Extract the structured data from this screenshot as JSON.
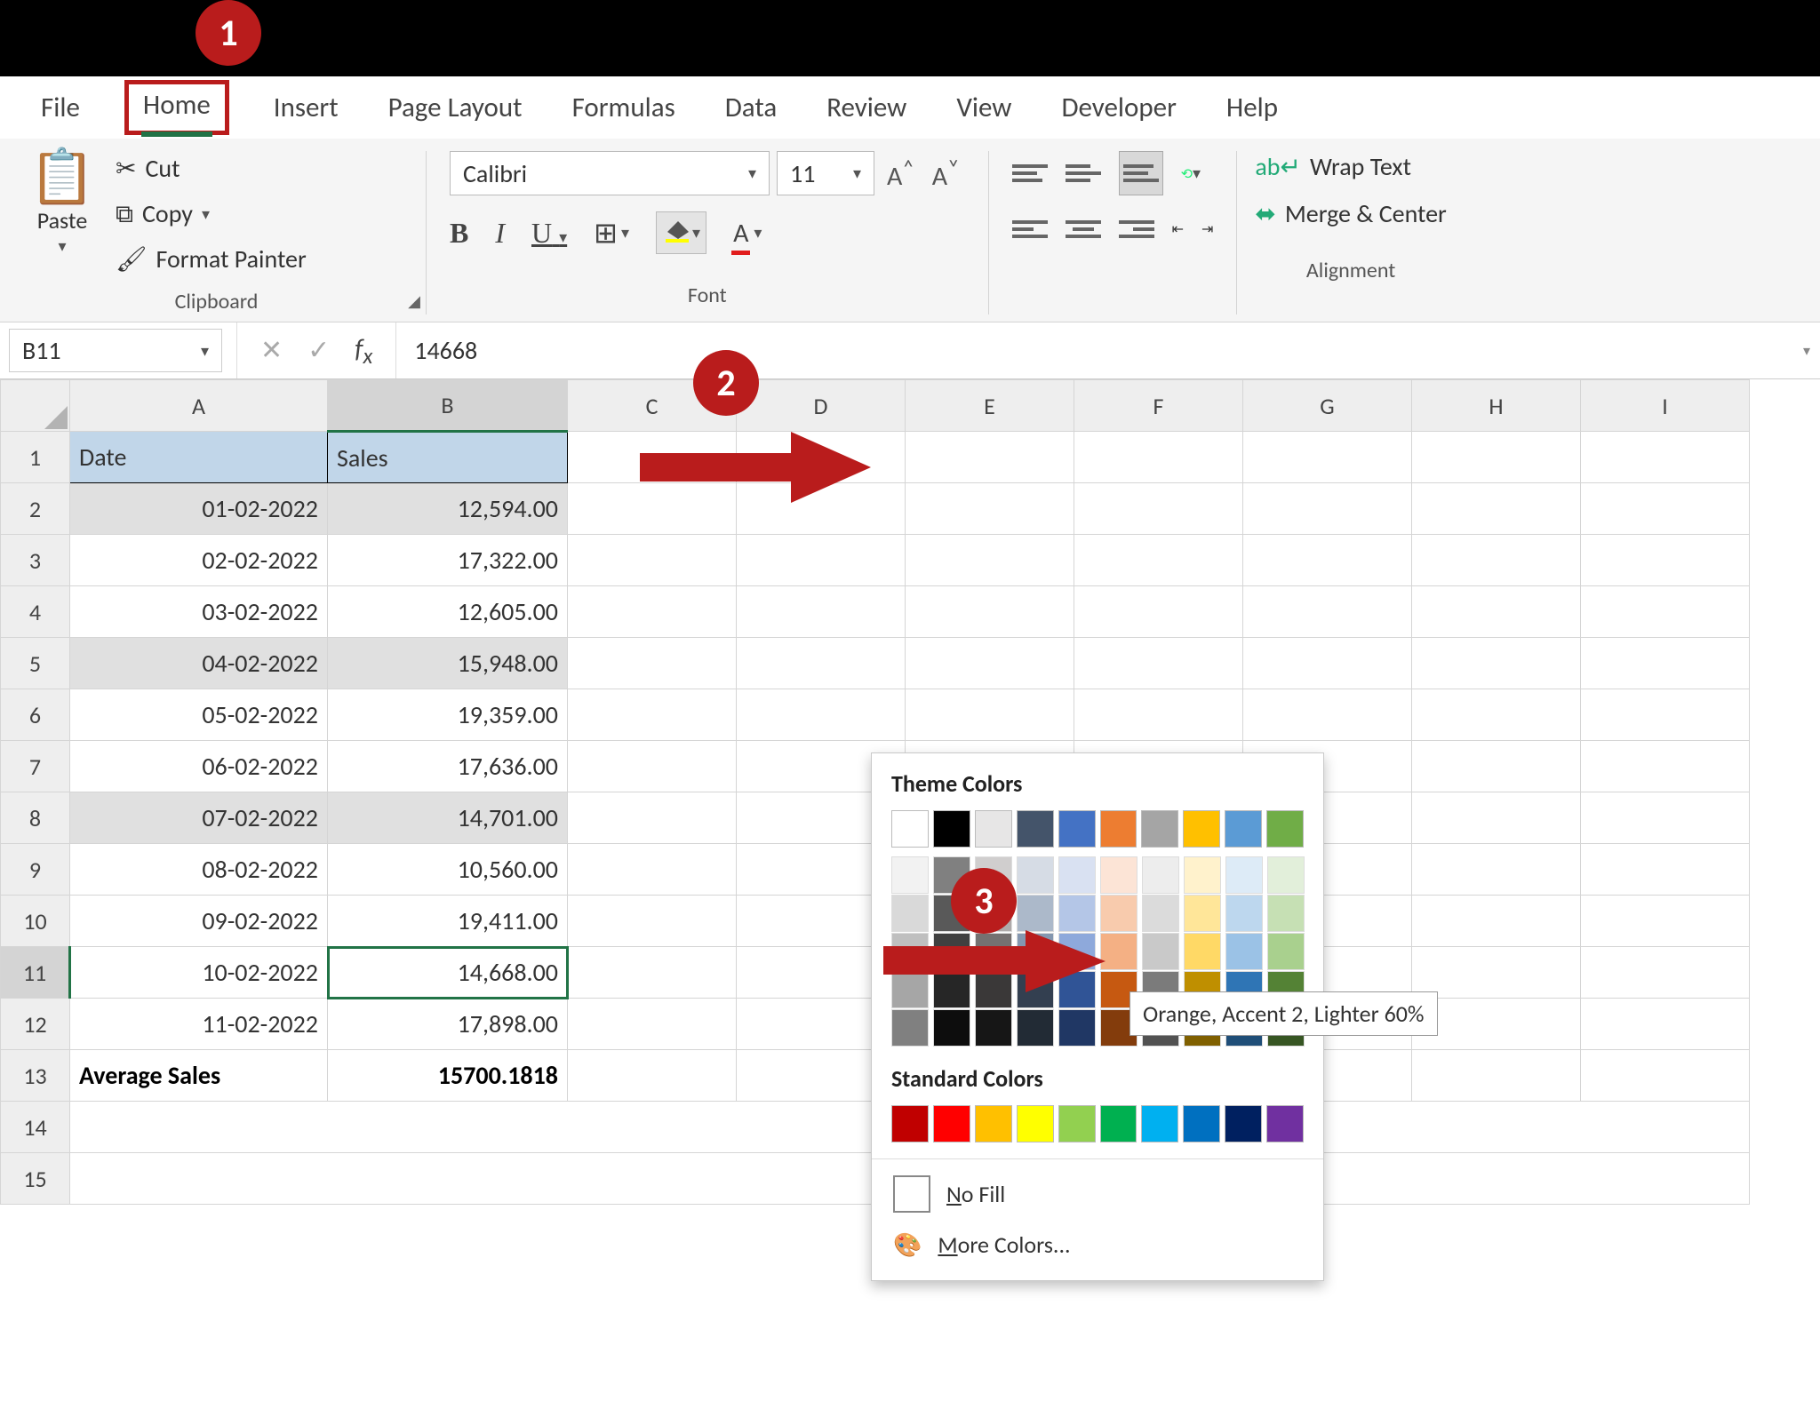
{
  "callouts": {
    "one": "1",
    "two": "2",
    "three": "3"
  },
  "tabs": [
    "File",
    "Home",
    "Insert",
    "Page Layout",
    "Formulas",
    "Data",
    "Review",
    "View",
    "Developer",
    "Help"
  ],
  "active_tab": "Home",
  "clipboard": {
    "paste": "Paste",
    "cut": "Cut",
    "copy": "Copy",
    "painter": "Format Painter",
    "label": "Clipboard"
  },
  "font": {
    "name": "Calibri",
    "size": "11",
    "label": "Font",
    "bold": "B",
    "italic": "I",
    "underline": "U"
  },
  "alignment": {
    "wrap": "Wrap Text",
    "merge": "Merge & Center",
    "label": "Alignment"
  },
  "namebox": "B11",
  "formula_value": "14668",
  "columns": [
    "A",
    "B",
    "C",
    "D",
    "E",
    "F",
    "G",
    "H",
    "I"
  ],
  "row_numbers": [
    1,
    2,
    3,
    4,
    5,
    6,
    7,
    8,
    9,
    10,
    11,
    12,
    13,
    14,
    15
  ],
  "headers": {
    "date": "Date",
    "sales": "Sales"
  },
  "rows": [
    {
      "date": "01-02-2022",
      "sales": "12,594.00",
      "stripe": true
    },
    {
      "date": "02-02-2022",
      "sales": "17,322.00",
      "stripe": false
    },
    {
      "date": "03-02-2022",
      "sales": "12,605.00",
      "stripe": false
    },
    {
      "date": "04-02-2022",
      "sales": "15,948.00",
      "stripe": true
    },
    {
      "date": "05-02-2022",
      "sales": "19,359.00",
      "stripe": false
    },
    {
      "date": "06-02-2022",
      "sales": "17,636.00",
      "stripe": false
    },
    {
      "date": "07-02-2022",
      "sales": "14,701.00",
      "stripe": true
    },
    {
      "date": "08-02-2022",
      "sales": "10,560.00",
      "stripe": false
    },
    {
      "date": "09-02-2022",
      "sales": "19,411.00",
      "stripe": false
    },
    {
      "date": "10-02-2022",
      "sales": "14,668.00",
      "stripe": false
    },
    {
      "date": "11-02-2022",
      "sales": "17,898.00",
      "stripe": false
    }
  ],
  "summary": {
    "label": "Average Sales",
    "value": "15700.1818"
  },
  "picker": {
    "theme_title": "Theme Colors",
    "standard_title": "Standard Colors",
    "no_fill_prefix": "N",
    "no_fill_rest": "o Fill",
    "more_prefix": "M",
    "more_rest": "ore Colors...",
    "tooltip": "Orange, Accent 2, Lighter 60%",
    "theme_top": [
      "#ffffff",
      "#000000",
      "#e7e6e6",
      "#44546a",
      "#4472c4",
      "#ed7d31",
      "#a5a5a5",
      "#ffc000",
      "#5b9bd5",
      "#70ad47"
    ],
    "theme_shades": [
      [
        "#f2f2f2",
        "#d9d9d9",
        "#bfbfbf",
        "#a6a6a6",
        "#808080"
      ],
      [
        "#808080",
        "#595959",
        "#404040",
        "#262626",
        "#0d0d0d"
      ],
      [
        "#d0cece",
        "#aeaaaa",
        "#757171",
        "#3a3838",
        "#161616"
      ],
      [
        "#d6dce5",
        "#acb9ca",
        "#8497b0",
        "#333f50",
        "#222b35"
      ],
      [
        "#d9e1f2",
        "#b4c6e7",
        "#8ea9db",
        "#305496",
        "#203764"
      ],
      [
        "#fce4d6",
        "#f8cbad",
        "#f4b084",
        "#c65911",
        "#833c0c"
      ],
      [
        "#ededed",
        "#dbdbdb",
        "#c9c9c9",
        "#7b7b7b",
        "#525252"
      ],
      [
        "#fff2cc",
        "#ffe699",
        "#ffd966",
        "#bf8f00",
        "#806000"
      ],
      [
        "#ddebf7",
        "#bdd7ee",
        "#9bc2e6",
        "#2f75b5",
        "#1f4e78"
      ],
      [
        "#e2efda",
        "#c6e0b4",
        "#a9d08e",
        "#548235",
        "#375623"
      ]
    ],
    "standard": [
      "#c00000",
      "#ff0000",
      "#ffc000",
      "#ffff00",
      "#92d050",
      "#00b050",
      "#00b0f0",
      "#0070c0",
      "#002060",
      "#7030a0"
    ]
  },
  "chart_data": {
    "type": "table",
    "columns": [
      "Date",
      "Sales"
    ],
    "rows": [
      [
        "01-02-2022",
        12594.0
      ],
      [
        "02-02-2022",
        17322.0
      ],
      [
        "03-02-2022",
        12605.0
      ],
      [
        "04-02-2022",
        15948.0
      ],
      [
        "05-02-2022",
        19359.0
      ],
      [
        "06-02-2022",
        17636.0
      ],
      [
        "07-02-2022",
        14701.0
      ],
      [
        "08-02-2022",
        10560.0
      ],
      [
        "09-02-2022",
        19411.0
      ],
      [
        "10-02-2022",
        14668.0
      ],
      [
        "11-02-2022",
        17898.0
      ]
    ],
    "summary": {
      "label": "Average Sales",
      "value": 15700.1818
    }
  }
}
